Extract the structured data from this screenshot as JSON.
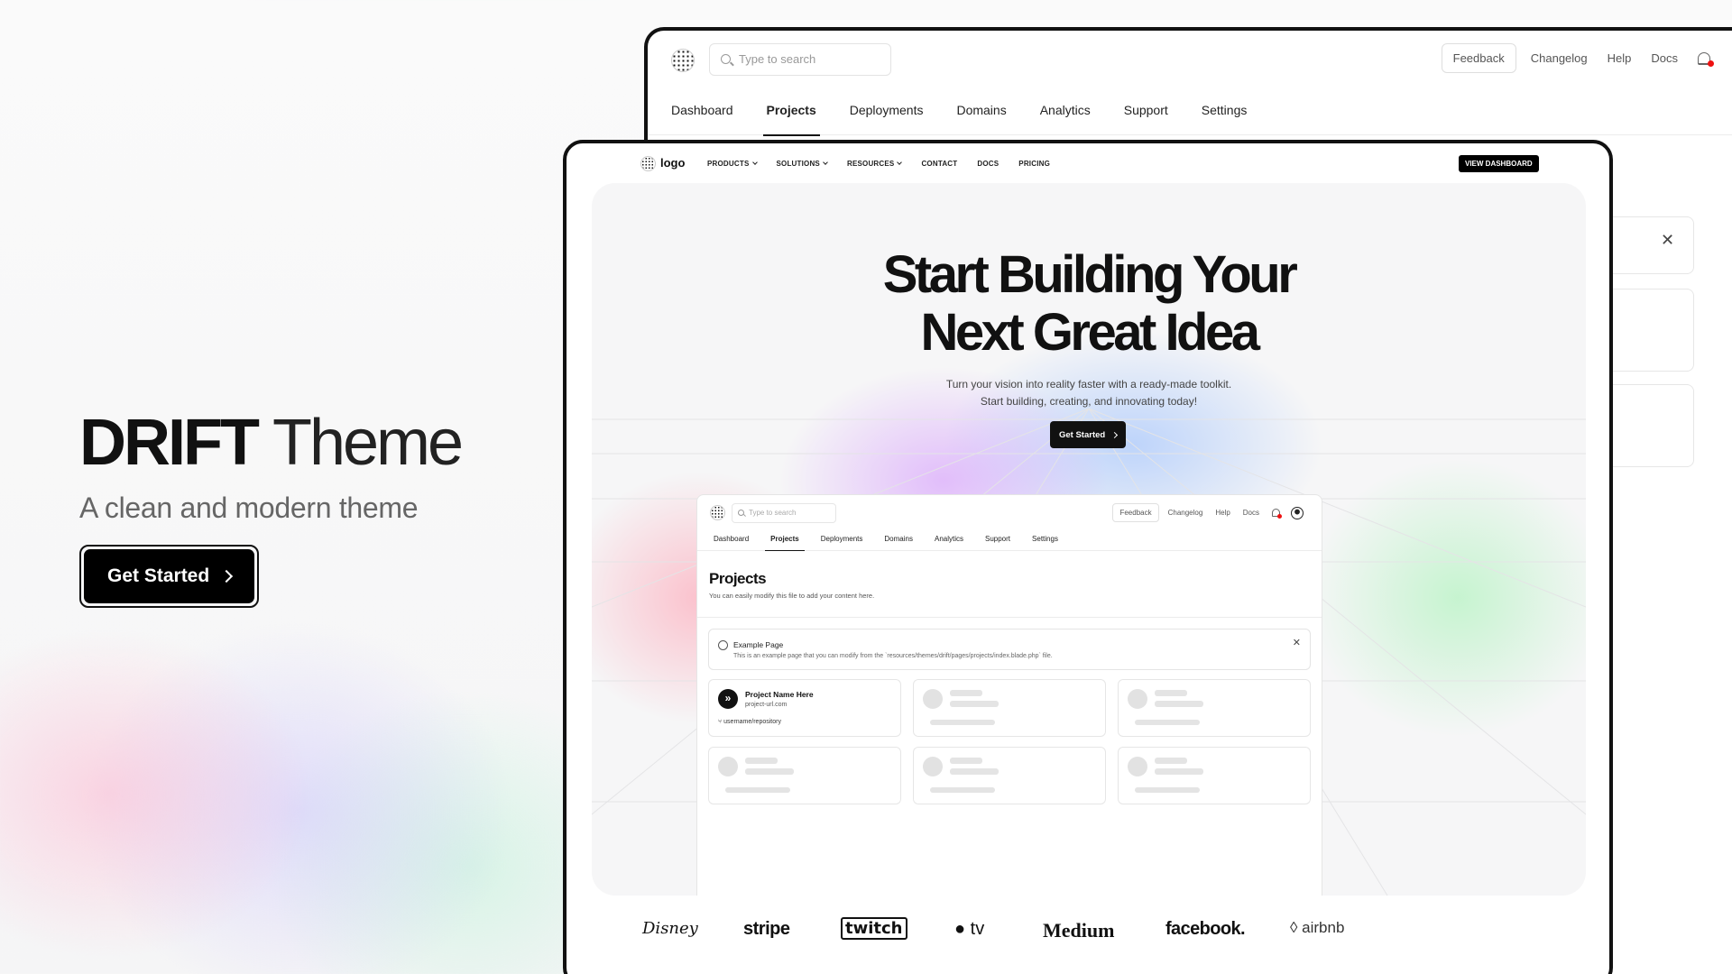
{
  "hero": {
    "title_strong": "DRIFT",
    "title_light": "Theme",
    "subtitle": "A clean and modern theme",
    "cta_label": "Get Started"
  },
  "dashboard": {
    "search_placeholder": "Type to search",
    "feedback_label": "Feedback",
    "links": [
      "Changelog",
      "Help",
      "Docs"
    ],
    "tabs": [
      {
        "label": "Dashboard",
        "active": false
      },
      {
        "label": "Projects",
        "active": true
      },
      {
        "label": "Deployments",
        "active": false
      },
      {
        "label": "Domains",
        "active": false
      },
      {
        "label": "Analytics",
        "active": false
      },
      {
        "label": "Support",
        "active": false
      },
      {
        "label": "Settings",
        "active": false
      }
    ]
  },
  "landing": {
    "logo_text": "logo",
    "menu": [
      {
        "label": "PRODUCTS",
        "dropdown": true
      },
      {
        "label": "SOLUTIONS",
        "dropdown": true
      },
      {
        "label": "RESOURCES",
        "dropdown": true
      },
      {
        "label": "CONTACT",
        "dropdown": false
      },
      {
        "label": "DOCS",
        "dropdown": false
      },
      {
        "label": "PRICING",
        "dropdown": false
      }
    ],
    "view_dashboard_label": "VIEW DASHBOARD",
    "headline_line1": "Start Building Your",
    "headline_line2": "Next Great Idea",
    "desc_line1": "Turn your vision into reality faster with a ready-made toolkit.",
    "desc_line2": "Start building, creating, and innovating today!",
    "cta_label": "Get Started",
    "inner": {
      "search_placeholder": "Type to search",
      "feedback_label": "Feedback",
      "links": [
        "Changelog",
        "Help",
        "Docs"
      ],
      "tabs": [
        {
          "label": "Dashboard",
          "active": false
        },
        {
          "label": "Projects",
          "active": true
        },
        {
          "label": "Deployments",
          "active": false
        },
        {
          "label": "Domains",
          "active": false
        },
        {
          "label": "Analytics",
          "active": false
        },
        {
          "label": "Support",
          "active": false
        },
        {
          "label": "Settings",
          "active": false
        }
      ],
      "page_title": "Projects",
      "page_desc": "You can easily modify this file to add your content here.",
      "alert_title": "Example Page",
      "alert_text": "This is an example page that you can modify from the `resources/themes/drift/pages/projects/index.blade.php` file.",
      "project": {
        "name": "Project Name Here",
        "url": "project-url.com",
        "repo": "username/repository"
      }
    },
    "brand_logos": [
      "Disney",
      "stripe",
      "twitch",
      "tv",
      "Medium",
      "facebook.",
      "airbnb"
    ]
  }
}
